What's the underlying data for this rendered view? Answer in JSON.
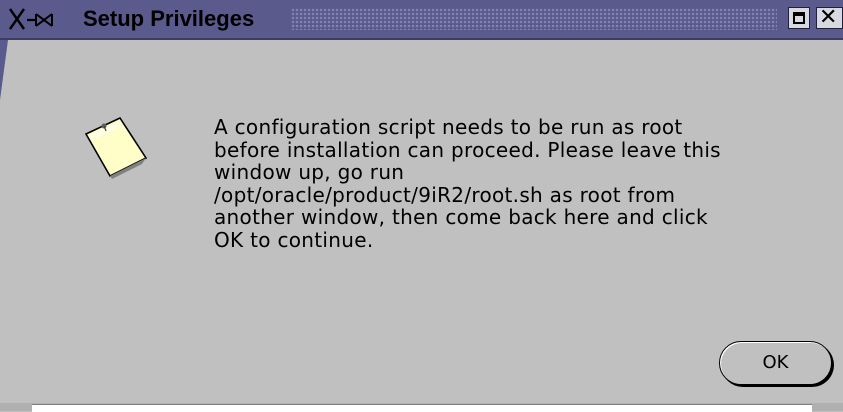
{
  "window": {
    "title": "Setup Privileges",
    "menu_control_glyph": "╳⊸⋈",
    "maximize_icon": "maximize-icon",
    "close_icon": "close-icon",
    "close_glyph": "✕"
  },
  "dialog": {
    "icon": "note-icon",
    "message": "A configuration script needs to be run as root\nbefore installation can proceed. Please leave this\nwindow up, go run\n/opt/oracle/product/9iR2/root.sh as root from\nanother window, then come back here and click\nOK to continue.",
    "ok_label": "OK"
  },
  "colors": {
    "titlebar": "#5a5a8c",
    "background": "#c0c0c0",
    "note_fill": "#fffdc8"
  }
}
